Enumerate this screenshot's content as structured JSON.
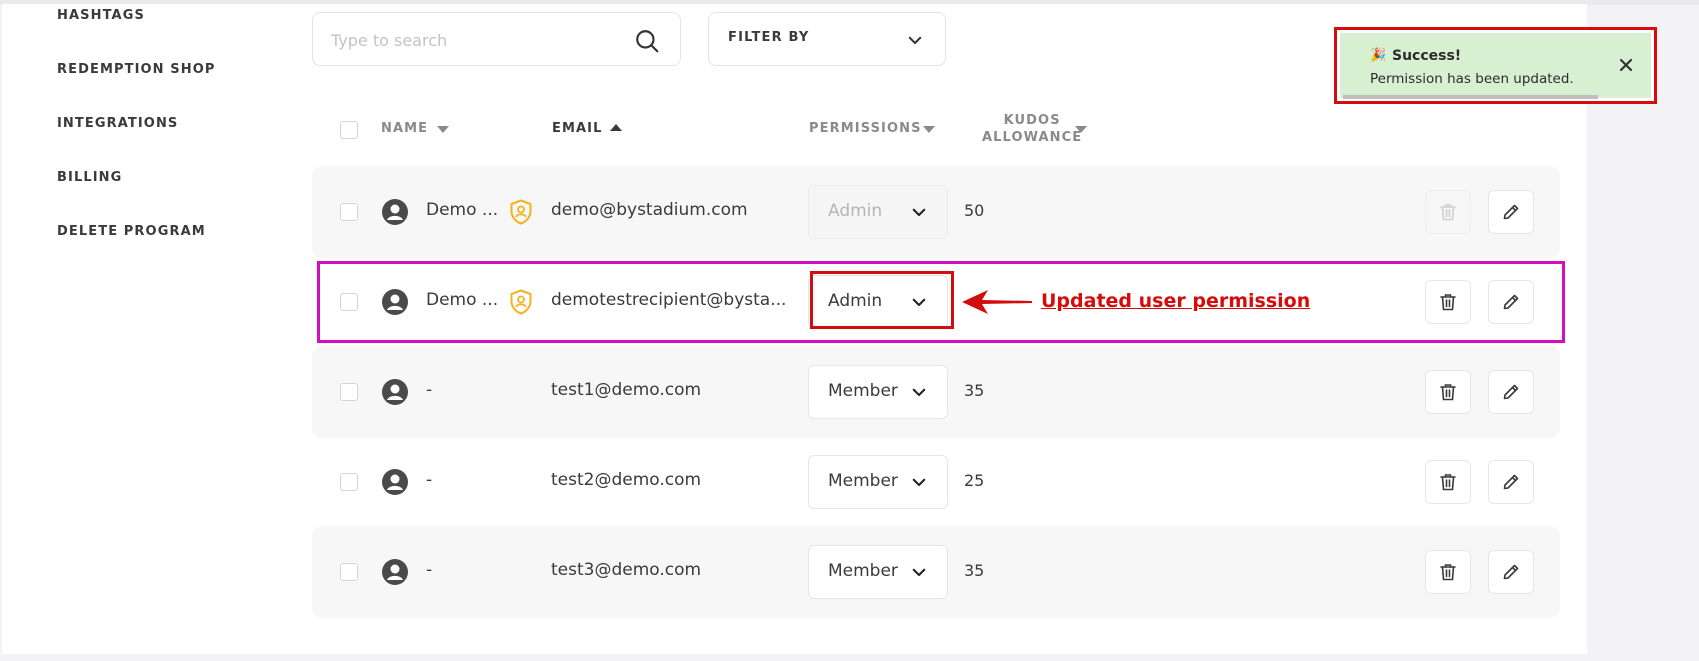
{
  "sidebar": {
    "items": [
      {
        "label": "HASHTAGS"
      },
      {
        "label": "REDEMPTION SHOP"
      },
      {
        "label": "INTEGRATIONS"
      },
      {
        "label": "BILLING"
      },
      {
        "label": "DELETE PROGRAM"
      }
    ]
  },
  "search": {
    "placeholder": "Type to search",
    "value": ""
  },
  "filter": {
    "label": "FILTER BY"
  },
  "table": {
    "headers": {
      "name": "NAME",
      "email": "EMAIL",
      "permissions": "PERMISSIONS",
      "kudos_line1": "KUDOS",
      "kudos_line2": "ALLOWANCE"
    },
    "rows": [
      {
        "name": "Demo ...",
        "is_admin_badge": true,
        "email": "demo@bystadium.com",
        "permission": "Admin",
        "permission_disabled": true,
        "kudos": "50",
        "delete_disabled": true
      },
      {
        "name": "Demo ...",
        "is_admin_badge": true,
        "email": "demotestrecipient@bysta...",
        "permission": "Admin",
        "permission_disabled": false,
        "kudos": "",
        "delete_disabled": false
      },
      {
        "name": "-",
        "is_admin_badge": false,
        "email": "test1@demo.com",
        "permission": "Member",
        "permission_disabled": false,
        "kudos": "35",
        "delete_disabled": false
      },
      {
        "name": "-",
        "is_admin_badge": false,
        "email": "test2@demo.com",
        "permission": "Member",
        "permission_disabled": false,
        "kudos": "25",
        "delete_disabled": false
      },
      {
        "name": "-",
        "is_admin_badge": false,
        "email": "test3@demo.com",
        "permission": "Member",
        "permission_disabled": false,
        "kudos": "35",
        "delete_disabled": false
      }
    ]
  },
  "annotation": {
    "text": "Updated user permission",
    "color": "#d80b0b",
    "row_highlight_color": "#d20fbf"
  },
  "toast": {
    "emoji": "🎉",
    "title": "Success!",
    "message": "Permission has been updated.",
    "background": "#d8f0d2"
  },
  "icons": {
    "search": "search-icon",
    "chevron": "chevron-down-icon",
    "sort_down": "caret-down-icon",
    "sort_up": "caret-up-icon",
    "avatar": "user-avatar-icon",
    "admin": "admin-shield-icon",
    "delete": "trash-icon",
    "edit": "pencil-icon",
    "close": "close-icon"
  }
}
